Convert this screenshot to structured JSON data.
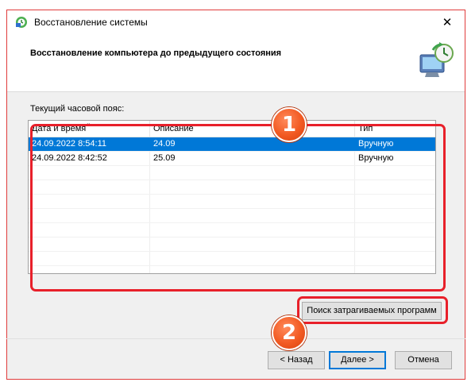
{
  "window": {
    "title": "Восстановление системы",
    "close_glyph": "✕",
    "app_icon": "system-restore-icon"
  },
  "header": {
    "heading": "Восстановление компьютера до предыдущего состояния",
    "icon": "system-restore-large-icon"
  },
  "timezone_label": "Текущий часовой пояс:",
  "table": {
    "columns": [
      "Дата и время",
      "Описание",
      "Тип"
    ],
    "rows": [
      {
        "date": "24.09.2022 8:54:11",
        "description": "24.09",
        "type": "Вручную",
        "selected": true
      },
      {
        "date": "24.09.2022 8:42:52",
        "description": "25.09",
        "type": "Вручную",
        "selected": false
      }
    ]
  },
  "buttons": {
    "search": "Поиск затрагиваемых программ",
    "back": "< Назад",
    "next": "Далее >",
    "cancel": "Отмена"
  },
  "annotations": {
    "badge1": "1",
    "badge2": "2",
    "highlight_color": "#e8202a",
    "badge_color": "#f25a22"
  },
  "colors": {
    "selection": "#0078d7"
  }
}
